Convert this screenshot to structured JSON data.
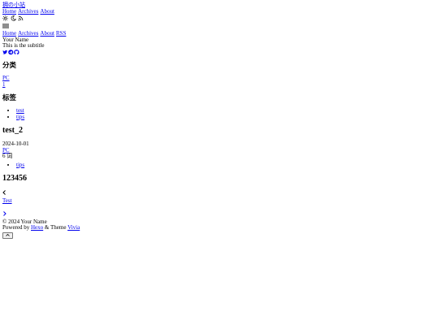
{
  "site": {
    "title": "拥の小站",
    "nav": [
      "Home",
      "Archives",
      "About"
    ],
    "author": "Your Name",
    "subtitle": "This is the subtitle"
  },
  "header_icons": [
    "sun-icon",
    "moon-icon",
    "rss-icon"
  ],
  "mobile_nav": [
    "Home",
    "Archives",
    "About",
    "RSS"
  ],
  "social_icons": [
    "twitter-icon",
    "telegram-icon",
    "github-icon"
  ],
  "categories": {
    "heading": "分类",
    "items": [
      {
        "name": "PC",
        "count": "1"
      }
    ]
  },
  "tags": {
    "heading": "标签",
    "items": [
      "test",
      "tips"
    ]
  },
  "post": {
    "title": "test_2",
    "date": "2024-10-01",
    "category": "PC",
    "word_count": "6 词",
    "tags": [
      "tips"
    ],
    "body_heading": "123456"
  },
  "pager": {
    "prev_icon": "chevron-left-icon",
    "link": "Test",
    "next_icon": "chevron-right-icon"
  },
  "footer": {
    "copyright": "© 2024 Your Name",
    "powered_prefix": "Powered by",
    "hexo": "Hexo",
    "theme_sep": "& Theme",
    "theme": "Vivia",
    "top_icon": "chevron-up-icon"
  },
  "colors": {
    "link": "#0000ee",
    "visited": "#551a8b",
    "text": "#000000"
  }
}
